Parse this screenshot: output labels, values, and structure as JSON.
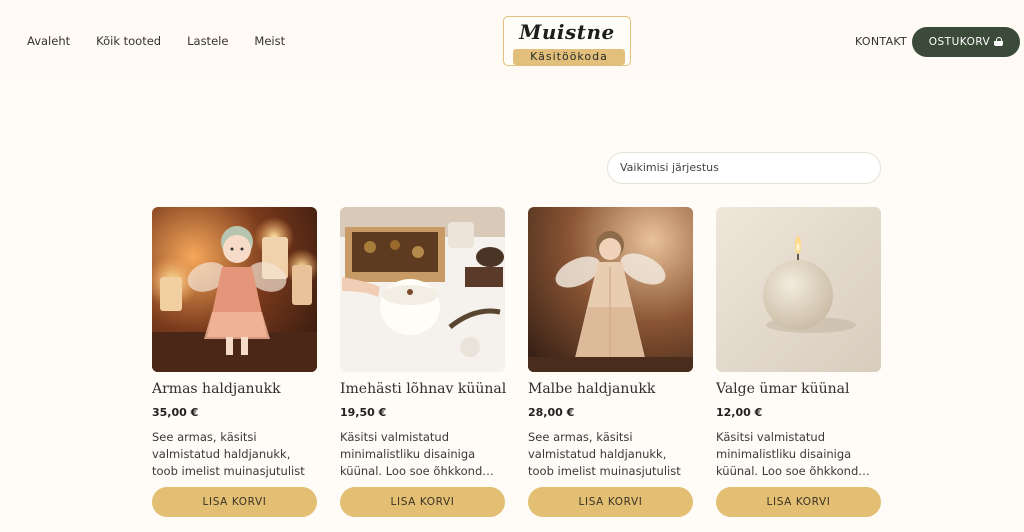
{
  "nav": {
    "links": [
      "Avaleht",
      "Kõik tooted",
      "Lastele",
      "Meist"
    ],
    "contact": "KONTAKT",
    "cart": "OSTUKORV"
  },
  "logo": {
    "title": "Muistne",
    "subtitle": "Käsitöökoda"
  },
  "sort": {
    "label": "Vaikimisi järjestus"
  },
  "products": [
    {
      "name": "Armas haldjanukk",
      "price": "35,00 €",
      "desc": "See armas, käsitsi valmistatud haldjanukk, toob imelist muinasjutulist hõngu…",
      "button": "LISA KORVI"
    },
    {
      "name": "Imehästi lõhnav küünal",
      "price": "19,50 €",
      "desc": "Käsitsi valmistatud minimalistliku disainiga küünal. Loo soe õhkkond…",
      "button": "LISA KORVI"
    },
    {
      "name": "Malbe haldjanukk",
      "price": "28,00 €",
      "desc": "See armas, käsitsi valmistatud haldjanukk, toob imelist muinasjutulist hõngu…",
      "button": "LISA KORVI"
    },
    {
      "name": "Valge ümar küünal",
      "price": "12,00 €",
      "desc": "Käsitsi valmistatud minimalistliku disainiga küünal. Loo soe õhkkond…",
      "button": "LISA KORVI"
    }
  ],
  "colors": {
    "accent": "#e3bf74",
    "cart_button": "#3c4a3a",
    "background": "#fffbf6"
  }
}
